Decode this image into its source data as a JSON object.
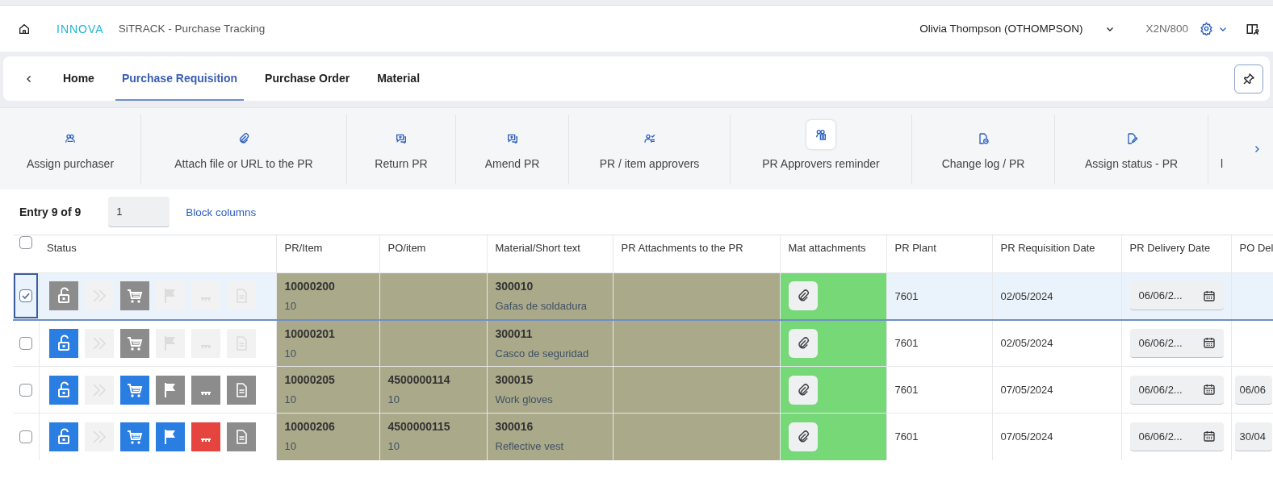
{
  "shell": {
    "logo": "INNOVA",
    "title": "SiTRACK - Purchase Tracking",
    "user": "Olivia Thompson (OTHOMPSON)",
    "system": "X2N/800"
  },
  "tabs": [
    {
      "label": "Home",
      "selected": false
    },
    {
      "label": "Purchase Requisition",
      "selected": true
    },
    {
      "label": "Purchase Order",
      "selected": false
    },
    {
      "label": "Material",
      "selected": false
    }
  ],
  "actions": [
    {
      "label": "Assign purchaser",
      "kind": "people",
      "hovered": false
    },
    {
      "label": "Attach file or URL to the PR",
      "kind": "clip",
      "hovered": false
    },
    {
      "label": "Return PR",
      "kind": "chat",
      "hovered": false
    },
    {
      "label": "Amend PR",
      "kind": "chat",
      "hovered": false
    },
    {
      "label": "PR / item approvers",
      "kind": "approvers",
      "hovered": false
    },
    {
      "label": "PR Approvers reminder",
      "kind": "reminder",
      "hovered": true
    },
    {
      "label": "Change log / PR",
      "kind": "log",
      "hovered": false
    },
    {
      "label": "Assign status - PR",
      "kind": "pen",
      "hovered": false
    },
    {
      "label": "l",
      "kind": "none"
    }
  ],
  "table": {
    "entry_label": "Entry 9 of 9",
    "entry_value": "1",
    "block_columns": "Block columns",
    "all_selected": false,
    "columns": [
      {
        "label": "Status"
      },
      {
        "label": "PR/Item",
        "color": "#aaa98a"
      },
      {
        "label": "PO/item",
        "color": "#aaa98a"
      },
      {
        "label": "Material/Short text",
        "color": "#aaa98a"
      },
      {
        "label": "PR Attachments to the PR",
        "color": "#aaa98a"
      },
      {
        "label": "Mat attachments",
        "color": "#76d876"
      },
      {
        "label": "PR Plant"
      },
      {
        "label": "PR Requisition Date"
      },
      {
        "label": "PR Delivery Date"
      },
      {
        "label": "PO Del"
      }
    ],
    "rows": [
      {
        "selected": true,
        "cells": [
          {
            "kind": "status",
            "icons": [
              {
                "kind": "lock",
                "color": "#8c8c8c",
                "disabled": false
              },
              {
                "kind": "forward",
                "color": "#f2f2f2",
                "disabled": true
              },
              {
                "kind": "cart",
                "color": "#8c8c8c",
                "disabled": false
              },
              {
                "kind": "flag",
                "color": "#f2f2f2",
                "disabled": true
              },
              {
                "kind": "dots",
                "color": "#f2f2f2",
                "disabled": true
              },
              {
                "kind": "doc",
                "color": "#f2f2f2",
                "disabled": true
              }
            ]
          },
          {
            "kind": "two_line",
            "main": "10000200",
            "sub": "10"
          },
          {
            "kind": "empty"
          },
          {
            "kind": "two_line",
            "main": "300010",
            "sub": "Gafas de soldadura"
          },
          {
            "kind": "empty"
          },
          {
            "kind": "attach_button"
          },
          {
            "kind": "text",
            "text": "7601"
          },
          {
            "kind": "text",
            "text": "02/05/2024"
          },
          {
            "kind": "date_field",
            "value": "06/06/2..."
          },
          {
            "kind": "empty"
          }
        ]
      },
      {
        "selected": false,
        "cells": [
          {
            "kind": "status",
            "icons": [
              {
                "kind": "lock",
                "color": "#2a7de1",
                "disabled": false
              },
              {
                "kind": "forward",
                "color": "#f2f2f2",
                "disabled": true
              },
              {
                "kind": "cart",
                "color": "#8c8c8c",
                "disabled": false
              },
              {
                "kind": "flag",
                "color": "#f2f2f2",
                "disabled": true
              },
              {
                "kind": "dots",
                "color": "#f2f2f2",
                "disabled": true
              },
              {
                "kind": "doc",
                "color": "#f2f2f2",
                "disabled": true
              }
            ]
          },
          {
            "kind": "two_line",
            "main": "10000201",
            "sub": "10"
          },
          {
            "kind": "empty"
          },
          {
            "kind": "two_line",
            "main": "300011",
            "sub": "Casco de seguridad"
          },
          {
            "kind": "empty"
          },
          {
            "kind": "attach_button"
          },
          {
            "kind": "text",
            "text": "7601"
          },
          {
            "kind": "text",
            "text": "02/05/2024"
          },
          {
            "kind": "date_field",
            "value": "06/06/2..."
          },
          {
            "kind": "empty"
          }
        ]
      },
      {
        "selected": false,
        "cells": [
          {
            "kind": "status",
            "icons": [
              {
                "kind": "lock",
                "color": "#2a7de1",
                "disabled": false
              },
              {
                "kind": "forward",
                "color": "#f2f2f2",
                "disabled": true
              },
              {
                "kind": "cart",
                "color": "#2a7de1",
                "disabled": false
              },
              {
                "kind": "flag",
                "color": "#8c8c8c",
                "disabled": false
              },
              {
                "kind": "dots",
                "color": "#8c8c8c",
                "disabled": false
              },
              {
                "kind": "doc",
                "color": "#8c8c8c",
                "disabled": false
              }
            ]
          },
          {
            "kind": "two_line",
            "main": "10000205",
            "sub": "10"
          },
          {
            "kind": "two_line",
            "main": "4500000114",
            "sub": "10"
          },
          {
            "kind": "two_line",
            "main": "300015",
            "sub": "Work gloves"
          },
          {
            "kind": "empty"
          },
          {
            "kind": "attach_button"
          },
          {
            "kind": "text",
            "text": "7601"
          },
          {
            "kind": "text",
            "text": "07/05/2024"
          },
          {
            "kind": "date_field",
            "value": "06/06/2..."
          },
          {
            "kind": "date_field",
            "value": "06/06"
          }
        ]
      },
      {
        "selected": false,
        "cells": [
          {
            "kind": "status",
            "icons": [
              {
                "kind": "lock",
                "color": "#2a7de1",
                "disabled": false
              },
              {
                "kind": "forward",
                "color": "#f2f2f2",
                "disabled": true
              },
              {
                "kind": "cart",
                "color": "#2a7de1",
                "disabled": false
              },
              {
                "kind": "flag",
                "color": "#2a7de1",
                "disabled": false
              },
              {
                "kind": "dots",
                "color": "#e5443f",
                "disabled": false
              },
              {
                "kind": "doc",
                "color": "#8c8c8c",
                "disabled": false
              }
            ]
          },
          {
            "kind": "two_line",
            "main": "10000206",
            "sub": "10"
          },
          {
            "kind": "two_line",
            "main": "4500000115",
            "sub": "10"
          },
          {
            "kind": "two_line",
            "main": "300016",
            "sub": "Reflective vest"
          },
          {
            "kind": "empty"
          },
          {
            "kind": "attach_button"
          },
          {
            "kind": "text",
            "text": "7601"
          },
          {
            "kind": "text",
            "text": "07/05/2024"
          },
          {
            "kind": "date_field",
            "value": "06/06/2..."
          },
          {
            "kind": "date_field",
            "value": "30/04"
          }
        ]
      }
    ]
  }
}
